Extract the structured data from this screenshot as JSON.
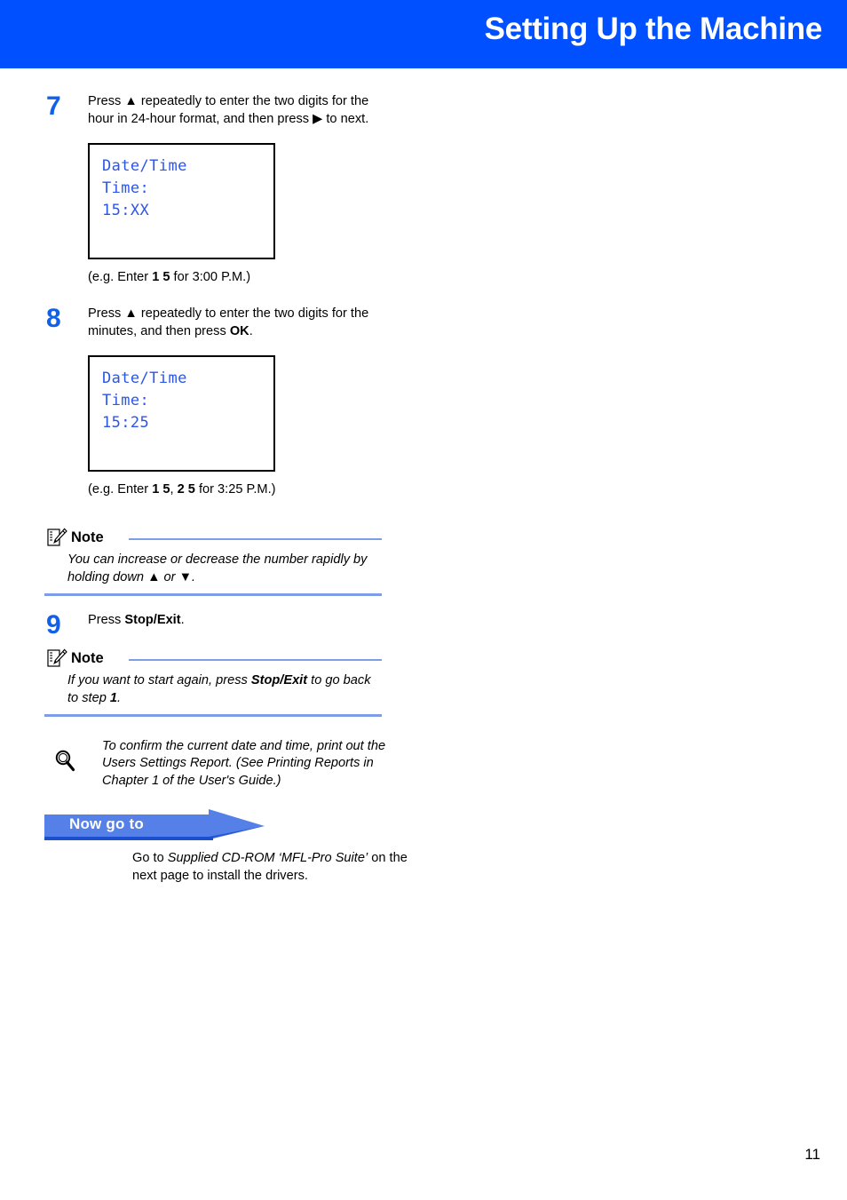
{
  "header": {
    "title": "Setting Up the Machine",
    "bg_color": "#0050ff",
    "text_color": "#ffffff"
  },
  "colors": {
    "step_number": "#1060e8",
    "lcd_text": "#2b55e8",
    "note_rule": "#7d9ee6",
    "nowgoto_fill": "#5580e8",
    "nowgoto_underline": "#1a4fd0"
  },
  "steps": [
    {
      "number": "7",
      "text": "Press ▲ repeatedly to enter the two digits for the hour in 24-hour format, and then press ▶ to next.",
      "lcd": {
        "line1": "Date/Time",
        "line2": "Time:",
        "line3": "15:XX"
      },
      "caption_prefix": "(e.g. Enter ",
      "caption_bold1": "1 5",
      "caption_suffix": " for 3:00 P.M.)"
    },
    {
      "number": "8",
      "text_prefix": "Press ▲ repeatedly to enter the two digits for the minutes, and then press ",
      "text_bold": "OK",
      "text_suffix": ".",
      "lcd": {
        "line1": "Date/Time",
        "line2": "Time:",
        "line3": "15:25"
      },
      "caption_prefix": "(e.g. Enter ",
      "caption_bold1": "1 5",
      "caption_mid": ", ",
      "caption_bold2": "2 5",
      "caption_suffix": " for 3:25 P.M.)"
    },
    {
      "number": "9",
      "text_prefix": "Press ",
      "text_bold": "Stop/Exit",
      "text_suffix": "."
    }
  ],
  "notes": [
    {
      "label": "Note",
      "icon": "note-pencil-icon",
      "body": "You can increase or decrease the number rapidly by holding down ▲ or ▼."
    },
    {
      "label": "Note",
      "icon": "note-pencil-icon",
      "body_prefix": "If you want to start again, press ",
      "body_bold1": "Stop/Exit",
      "body_mid": " to go back to step ",
      "body_bold2": "1",
      "body_suffix": "."
    }
  ],
  "tip": {
    "icon": "magnifier-icon",
    "text": "To confirm the current date and time, print out the Users Settings Report. (See Printing Reports in Chapter 1 of the User's Guide.)"
  },
  "nowgoto": {
    "label": "Now go to",
    "body_prefix": "Go to ",
    "body_italic": "Supplied CD-ROM ‘MFL-Pro Suite’",
    "body_suffix": " on the next page to install the drivers."
  },
  "footer": {
    "page_number": "11"
  }
}
